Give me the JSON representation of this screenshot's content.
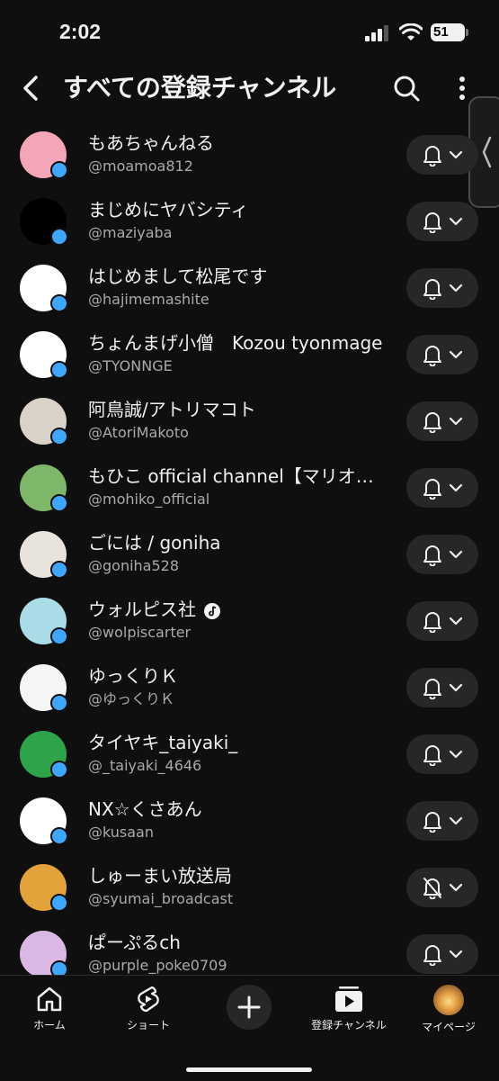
{
  "status": {
    "time": "2:02",
    "battery": "51"
  },
  "header": {
    "title": "すべての登録チャンネル"
  },
  "channels": [
    {
      "name": "もあちゃんねる",
      "handle": "@moamoa812",
      "avatar_bg": "#f4a6b8",
      "avatar_text": "",
      "bell": "on"
    },
    {
      "name": "まじめにヤバシティ",
      "handle": "@maziyaba",
      "avatar_bg": "#000000",
      "avatar_text": "",
      "bell": "on"
    },
    {
      "name": "はじめまして松尾です",
      "handle": "@hajimemashite",
      "avatar_bg": "#ffffff",
      "avatar_text": "",
      "bell": "on"
    },
    {
      "name": "ちょんまげ小僧　Kozou tyonmage",
      "handle": "@TYONNGE",
      "avatar_bg": "#ffffff",
      "avatar_text": "",
      "bell": "on"
    },
    {
      "name": "阿鳥誠/アトリマコト",
      "handle": "@AtoriMakoto",
      "avatar_bg": "#d9d2c8",
      "avatar_text": "",
      "bell": "on"
    },
    {
      "name": "もひこ official channel【マリオメーカー】",
      "handle": "@mohiko_official",
      "avatar_bg": "#7db86a",
      "avatar_text": "",
      "bell": "on"
    },
    {
      "name": "ごには / goniha",
      "handle": "@goniha528",
      "avatar_bg": "#e8e4dc",
      "avatar_text": "",
      "bell": "on"
    },
    {
      "name": "ウォルピス社",
      "handle": "@wolpiscarter",
      "avatar_bg": "#a9dce6",
      "avatar_text": "",
      "bell": "on",
      "verified": true
    },
    {
      "name": "ゆっくりＫ",
      "handle": "@ゆっくりＫ",
      "avatar_bg": "#f5f5f5",
      "avatar_text": "",
      "bell": "on"
    },
    {
      "name": "タイヤキ_taiyaki_",
      "handle": "@_taiyaki_4646",
      "avatar_bg": "#2fa34a",
      "avatar_text": "",
      "bell": "on"
    },
    {
      "name": "NX☆くさあん",
      "handle": "@kusaan",
      "avatar_bg": "#ffffff",
      "avatar_text": "",
      "bell": "on"
    },
    {
      "name": "しゅーまい放送局",
      "handle": "@syumai_broadcast",
      "avatar_bg": "#e4a33a",
      "avatar_text": "",
      "bell": "off"
    },
    {
      "name": "ぱーぷるch",
      "handle": "@purple_poke0709",
      "avatar_bg": "#d9b8e6",
      "avatar_text": "",
      "bell": "on"
    }
  ],
  "nav": {
    "home": "ホーム",
    "shorts": "ショート",
    "subscriptions": "登録チャンネル",
    "mypage": "マイページ"
  }
}
